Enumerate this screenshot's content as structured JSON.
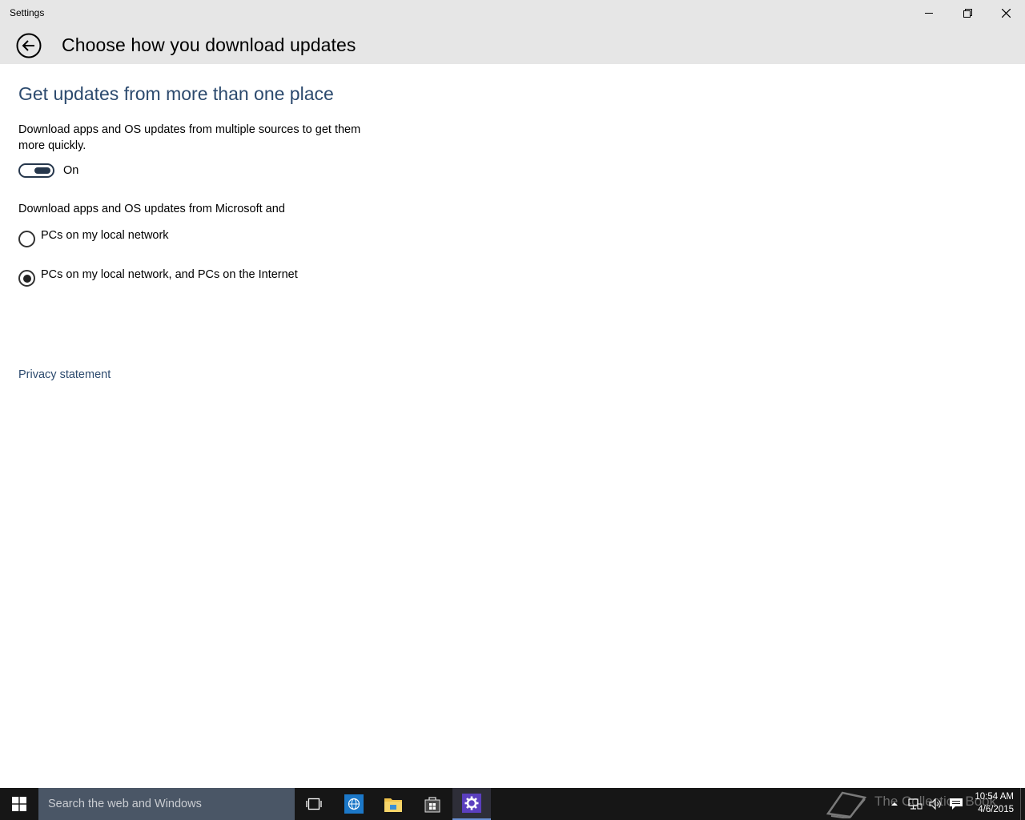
{
  "window": {
    "app_title": "Settings",
    "page_title": "Choose how you download updates"
  },
  "section": {
    "heading": "Get updates from more than one place",
    "description": "Download apps and OS updates from multiple sources to get them more quickly.",
    "toggle": {
      "state_label": "On",
      "checked": true
    },
    "radio_intro": "Download apps and OS updates from Microsoft and",
    "options": [
      {
        "label": "PCs on my local network",
        "selected": false
      },
      {
        "label": "PCs on my local network, and PCs on the Internet",
        "selected": true
      }
    ],
    "privacy_link": "Privacy statement"
  },
  "taskbar": {
    "search_placeholder": "Search the web and Windows",
    "watermark": "The Collection Book",
    "time": "10:54 AM",
    "date": "4/6/2015"
  },
  "colors": {
    "titlebar_bg": "#e6e6e6",
    "heading_accent": "#2c4a6e",
    "taskbar_bg": "#161616",
    "search_bg": "#4a5666",
    "settings_icon_bg": "#5b3fbf"
  },
  "icons": {
    "back": "back-arrow-icon",
    "minimize": "minimize-icon",
    "maximize": "restore-icon",
    "close": "close-icon",
    "start": "windows-logo-icon",
    "task_view": "task-view-icon",
    "browser": "globe-icon",
    "explorer": "folder-icon",
    "store": "store-bag-icon",
    "settings": "gear-icon"
  }
}
